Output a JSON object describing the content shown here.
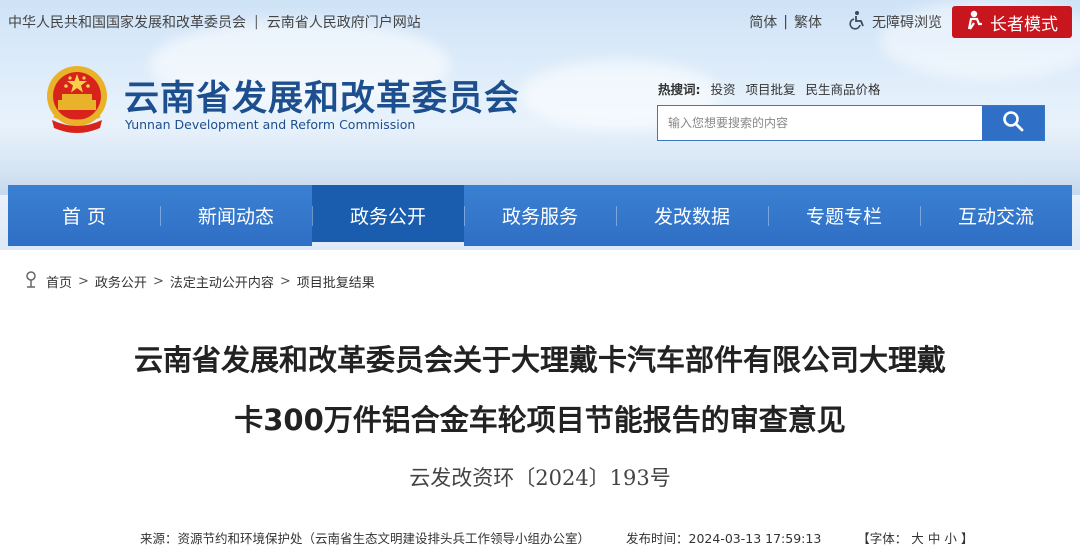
{
  "topbar": {
    "gov_link": "中华人民共和国国家发展和改革委员会",
    "separator": "|",
    "portal_link": "云南省人民政府门户网站",
    "simplified": "简体",
    "traditional": "繁体",
    "accessibility": "无障碍浏览",
    "elder_mode": "长者模式"
  },
  "site": {
    "name": "云南省发展和改革委员会",
    "name_en": "Yunnan Development and Reform Commission"
  },
  "search": {
    "hot_label": "热搜词:",
    "hot_terms": [
      "投资",
      "项目批复",
      "民生商品价格"
    ],
    "placeholder": "输入您想要搜索的内容"
  },
  "nav": {
    "items": [
      "首 页",
      "新闻动态",
      "政务公开",
      "政务服务",
      "发改数据",
      "专题专栏",
      "互动交流"
    ],
    "active_index": 2
  },
  "breadcrumb": {
    "items": [
      "首页",
      "政务公开",
      "法定主动公开内容",
      "项目批复结果"
    ],
    "arrow": ">"
  },
  "article": {
    "title_line1": "云南省发展和改革委员会关于大理戴卡汽车部件有限公司大理戴",
    "title_line2": "卡300万件铝合金车轮项目节能报告的审查意见",
    "doc_number": "云发改资环〔2024〕193号",
    "source": "来源：资源节约和环境保护处（云南省生态文明建设排头兵工作领导小组办公室）",
    "published": "发布时间：2024-03-13 17:59:13",
    "font_label": "【字体：",
    "font_sizes": [
      "大",
      "中",
      "小"
    ],
    "font_end": "】"
  },
  "colors": {
    "brand_blue": "#2f6fc5",
    "nav_active": "#1a5cae",
    "elder_red": "#c8161e",
    "title_blue": "#1d4f8f"
  }
}
